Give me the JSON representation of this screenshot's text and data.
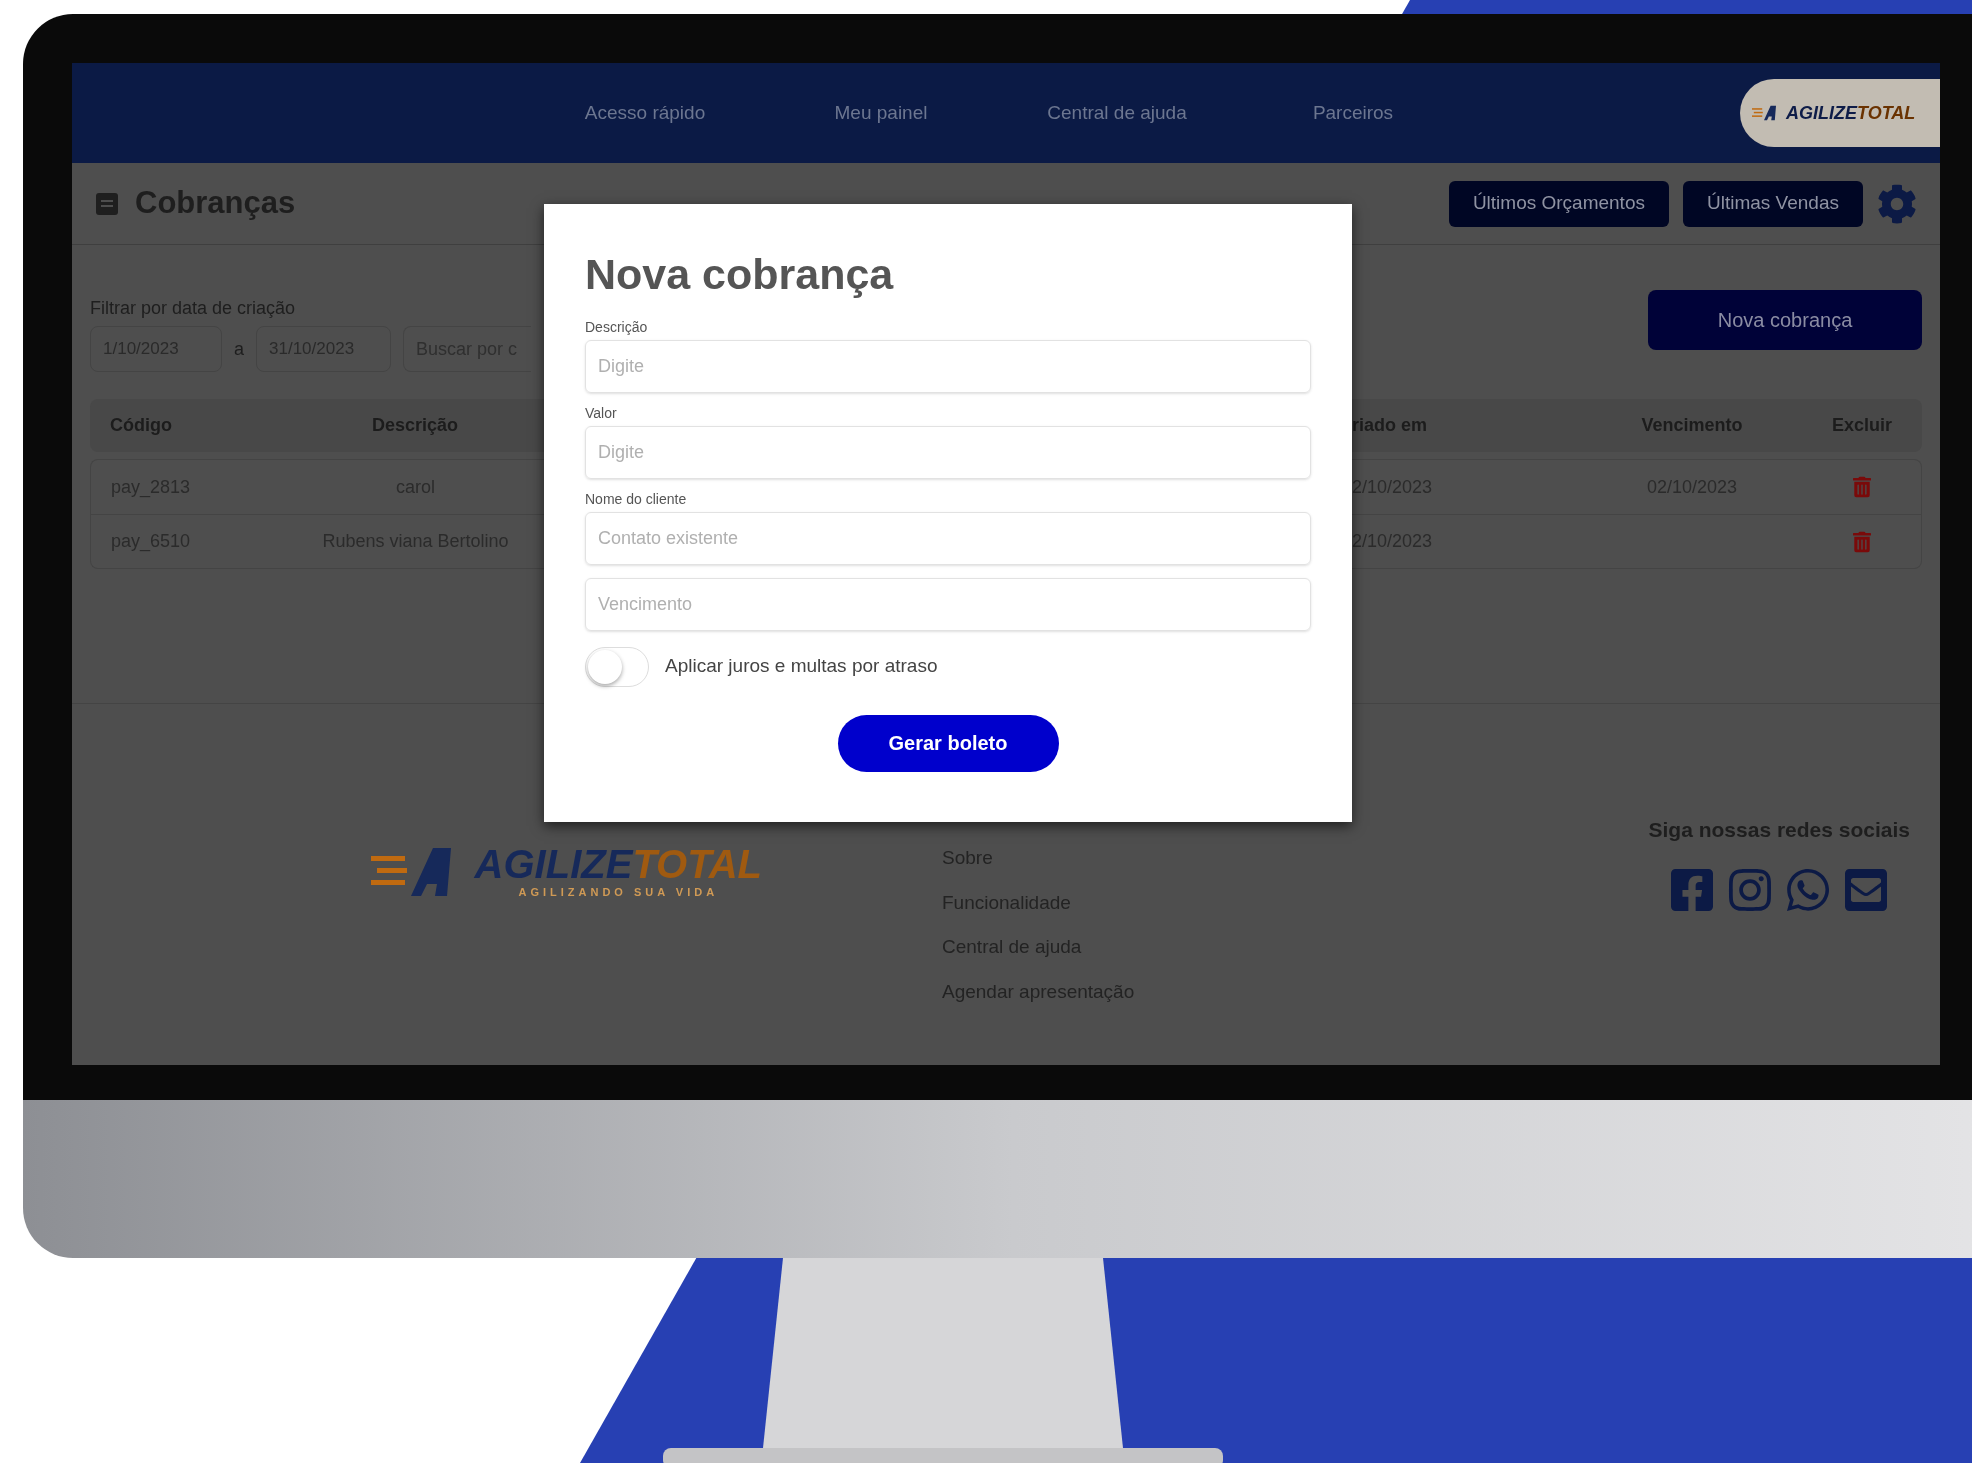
{
  "nav": {
    "links": [
      "Acesso rápido",
      "Meu painel",
      "Central de ajuda",
      "Parceiros"
    ],
    "logo": {
      "first": "AGILIZE",
      "second": "TOTAL"
    }
  },
  "header": {
    "title": "Cobranças",
    "buttons": [
      "Últimos Orçamentos",
      "Últimas Vendas"
    ]
  },
  "filter": {
    "label": "Filtrar por data de criação",
    "from": "1/10/2023",
    "separator": "a",
    "to": "31/10/2023",
    "search_placeholder": "Buscar por c",
    "new_button": "Nova cobrança"
  },
  "table": {
    "columns": [
      "Código",
      "Descrição",
      "riado em",
      "Vencimento",
      "Excluir"
    ],
    "rows": [
      {
        "code": "pay_2813",
        "description": "carol",
        "created": "2/10/2023",
        "due": "02/10/2023"
      },
      {
        "code": "pay_6510",
        "description": "Rubens viana Bertolino",
        "created": "2/10/2023",
        "due": ""
      }
    ]
  },
  "modal": {
    "title": "Nova cobrança",
    "fields": [
      {
        "label": "Descrição",
        "placeholder": "Digite"
      },
      {
        "label": "Valor",
        "placeholder": "Digite"
      },
      {
        "label": "Nome do cliente",
        "placeholder": "Contato existente"
      },
      {
        "placeholder": "Vencimento"
      }
    ],
    "toggle": {
      "label": "Aplicar juros e multas por atraso",
      "on": false
    },
    "button": "Gerar boleto"
  },
  "footer": {
    "logo": {
      "first": "AGILIZE",
      "second": "TOTAL",
      "tagline": "AGILIZANDO SUA VIDA"
    },
    "links": [
      "Sobre",
      "Funcionalidade",
      "Central de ajuda",
      "Agendar apresentação"
    ],
    "social_title": "Siga nossas redes sociais"
  }
}
